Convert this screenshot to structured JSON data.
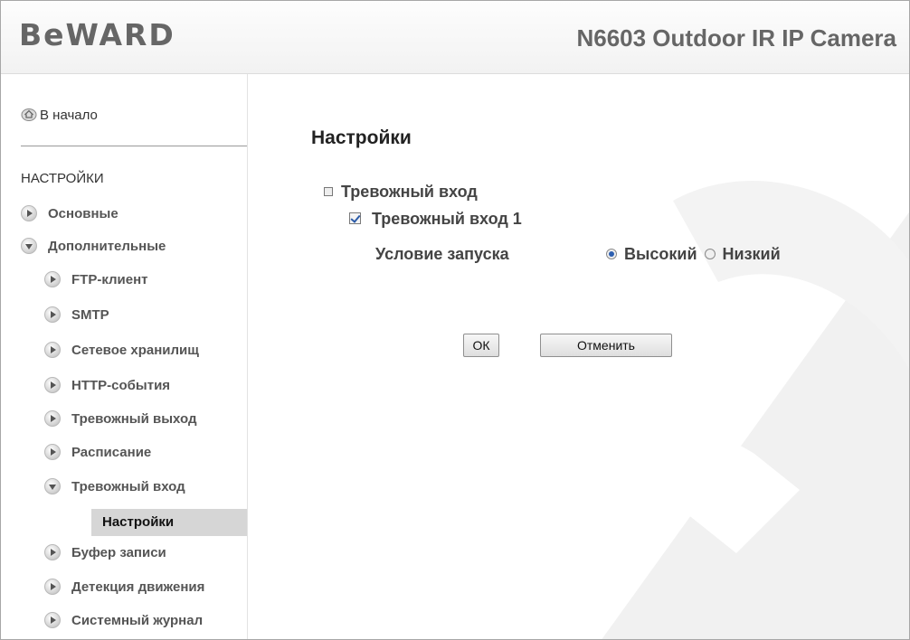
{
  "header": {
    "logo": "BeWARD",
    "model": "N6603 Outdoor IR IP Camera"
  },
  "sidebar": {
    "home_label": "В начало",
    "section_title": "НАСТРОЙКИ",
    "items": [
      {
        "label": "Основные",
        "state": "collapsed"
      },
      {
        "label": "Дополнительные",
        "state": "expanded"
      },
      {
        "label": "FTP-клиент",
        "state": "collapsed"
      },
      {
        "label": "SMTP",
        "state": "collapsed"
      },
      {
        "label": "Сетевое хранилищ",
        "state": "collapsed"
      },
      {
        "label": "HTTP-события",
        "state": "collapsed"
      },
      {
        "label": "Тревожный выход",
        "state": "collapsed"
      },
      {
        "label": "Расписание",
        "state": "collapsed"
      },
      {
        "label": "Тревожный вход",
        "state": "expanded"
      },
      {
        "label": "Буфер записи",
        "state": "collapsed"
      },
      {
        "label": "Детекция движения",
        "state": "collapsed"
      },
      {
        "label": "Системный журнал",
        "state": "collapsed"
      }
    ],
    "selected_subitem": "Настройки"
  },
  "main": {
    "title": "Настройки",
    "group_label": "Тревожный вход",
    "input_label": "Тревожный вход 1",
    "input_checked": true,
    "condition_label": "Условие запуска",
    "options": [
      {
        "label": "Высокий",
        "selected": true
      },
      {
        "label": "Низкий",
        "selected": false
      }
    ],
    "ok_label": "ОК",
    "cancel_label": "Отменить"
  }
}
